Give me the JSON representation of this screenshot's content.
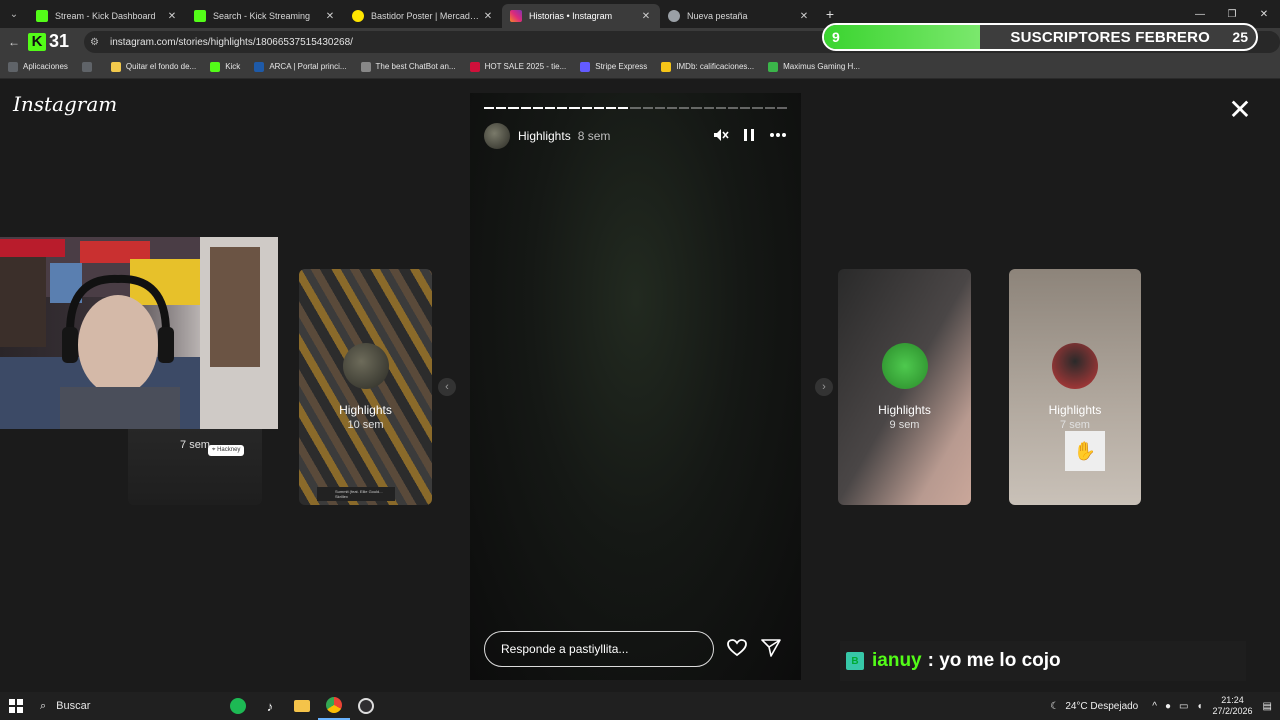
{
  "tabs": [
    {
      "title": "Stream - Kick Dashboard",
      "icon": "kick-icon",
      "color": "#53fc18",
      "active": false
    },
    {
      "title": "Search - Kick Streaming",
      "icon": "kick-icon",
      "color": "#53fc18",
      "active": false
    },
    {
      "title": "Bastidor Poster | MercadoLibre",
      "icon": "mercadolibre-icon",
      "color": "#ffe600",
      "active": false
    },
    {
      "title": "Historias • Instagram",
      "icon": "instagram-icon",
      "color": "#e1306c",
      "active": true
    },
    {
      "title": "Nueva pestaña",
      "icon": "globe-icon",
      "color": "#9aa0a6",
      "active": false
    }
  ],
  "address": {
    "url": "instagram.com/stories/highlights/18066537515430268/",
    "kick_label": "31"
  },
  "sub_goal": {
    "current": "9",
    "label": "SUSCRIPTORES FEBRERO",
    "goal": "25",
    "progress": 0.36
  },
  "bookmarks": [
    {
      "label": "Aplicaciones",
      "icon": "apps-icon",
      "color": "#5f6368"
    },
    {
      "label": "",
      "icon": "grid-icon",
      "color": "#5f6368"
    },
    {
      "label": "Quitar el fondo de...",
      "icon": "remove-bg-icon",
      "color": "#f2c94c"
    },
    {
      "label": "Kick",
      "icon": "kick-icon",
      "color": "#53fc18"
    },
    {
      "label": "ARCA | Portal princi...",
      "icon": "arca-icon",
      "color": "#1e5aa8"
    },
    {
      "label": "The best ChatBot an...",
      "icon": "chatbot-icon",
      "color": "#888888"
    },
    {
      "label": "HOT SALE 2025 - tie...",
      "icon": "hotsale-icon",
      "color": "#d0103a"
    },
    {
      "label": "Stripe Express",
      "icon": "stripe-icon",
      "color": "#635bff"
    },
    {
      "label": "IMDb: calificaciones...",
      "icon": "imdb-icon",
      "color": "#f5c518"
    },
    {
      "label": "Maximus Gaming H...",
      "icon": "maximus-icon",
      "color": "#3bb54a"
    }
  ],
  "instagram": {
    "logo": "Instagram",
    "story": {
      "user": "Highlights",
      "time": "8 sem",
      "segments_total": 25,
      "segments_done": 12,
      "reply_placeholder": "Responde a pastiyllita..."
    },
    "side_stories": [
      {
        "name": "Highlights",
        "time": "10 sem"
      },
      {
        "name": "Highlights",
        "time": "9 sem"
      },
      {
        "name": "Highlights",
        "time": "7 sem"
      }
    ],
    "left_partial_time": "7 sem",
    "left_partial_tag": "Hackney",
    "music_tag": "Summit (feat. Ellie Gould... Skrillex"
  },
  "chat": {
    "user": "ianuy",
    "message": ": yo me lo cojo"
  },
  "taskbar": {
    "search_label": "Buscar",
    "weather": "24°C Despejado",
    "time": "21:24",
    "date": "27/2/2026"
  }
}
